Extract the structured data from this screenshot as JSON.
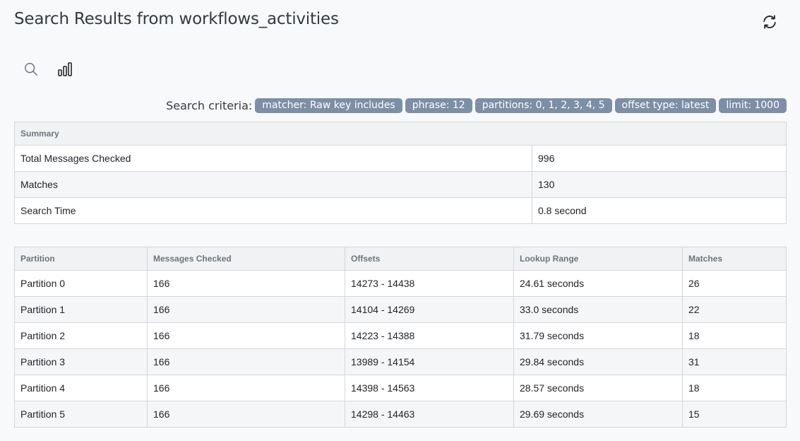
{
  "title": "Search Results from workflows_activities",
  "criteria": {
    "label": "Search criteria:",
    "badges": [
      "matcher: Raw key includes",
      "phrase: 12",
      "partitions: 0, 1, 2, 3, 4, 5",
      "offset type: latest",
      "limit: 1000"
    ]
  },
  "summary": {
    "header": "Summary",
    "rows": [
      {
        "label": "Total Messages Checked",
        "value": "996"
      },
      {
        "label": "Matches",
        "value": "130"
      },
      {
        "label": "Search Time",
        "value": "0.8 second"
      }
    ]
  },
  "partitions": {
    "columns": [
      "Partition",
      "Messages Checked",
      "Offsets",
      "Lookup Range",
      "Matches"
    ],
    "rows": [
      [
        "Partition 0",
        "166",
        "14273 - 14438",
        "24.61 seconds",
        "26"
      ],
      [
        "Partition 1",
        "166",
        "14104 - 14269",
        "33.0 seconds",
        "22"
      ],
      [
        "Partition 2",
        "166",
        "14223 - 14388",
        "31.79 seconds",
        "18"
      ],
      [
        "Partition 3",
        "166",
        "13989 - 14154",
        "29.84 seconds",
        "31"
      ],
      [
        "Partition 4",
        "166",
        "14398 - 14563",
        "28.57 seconds",
        "18"
      ],
      [
        "Partition 5",
        "166",
        "14298 - 14463",
        "29.69 seconds",
        "15"
      ]
    ]
  },
  "icons": {
    "refresh": "refresh-icon",
    "search": "search-icon",
    "stats": "bar-chart-icon"
  },
  "colors": {
    "badge": "#7d8ea7",
    "background": "#f8f9fb",
    "border": "#d3d6db"
  }
}
